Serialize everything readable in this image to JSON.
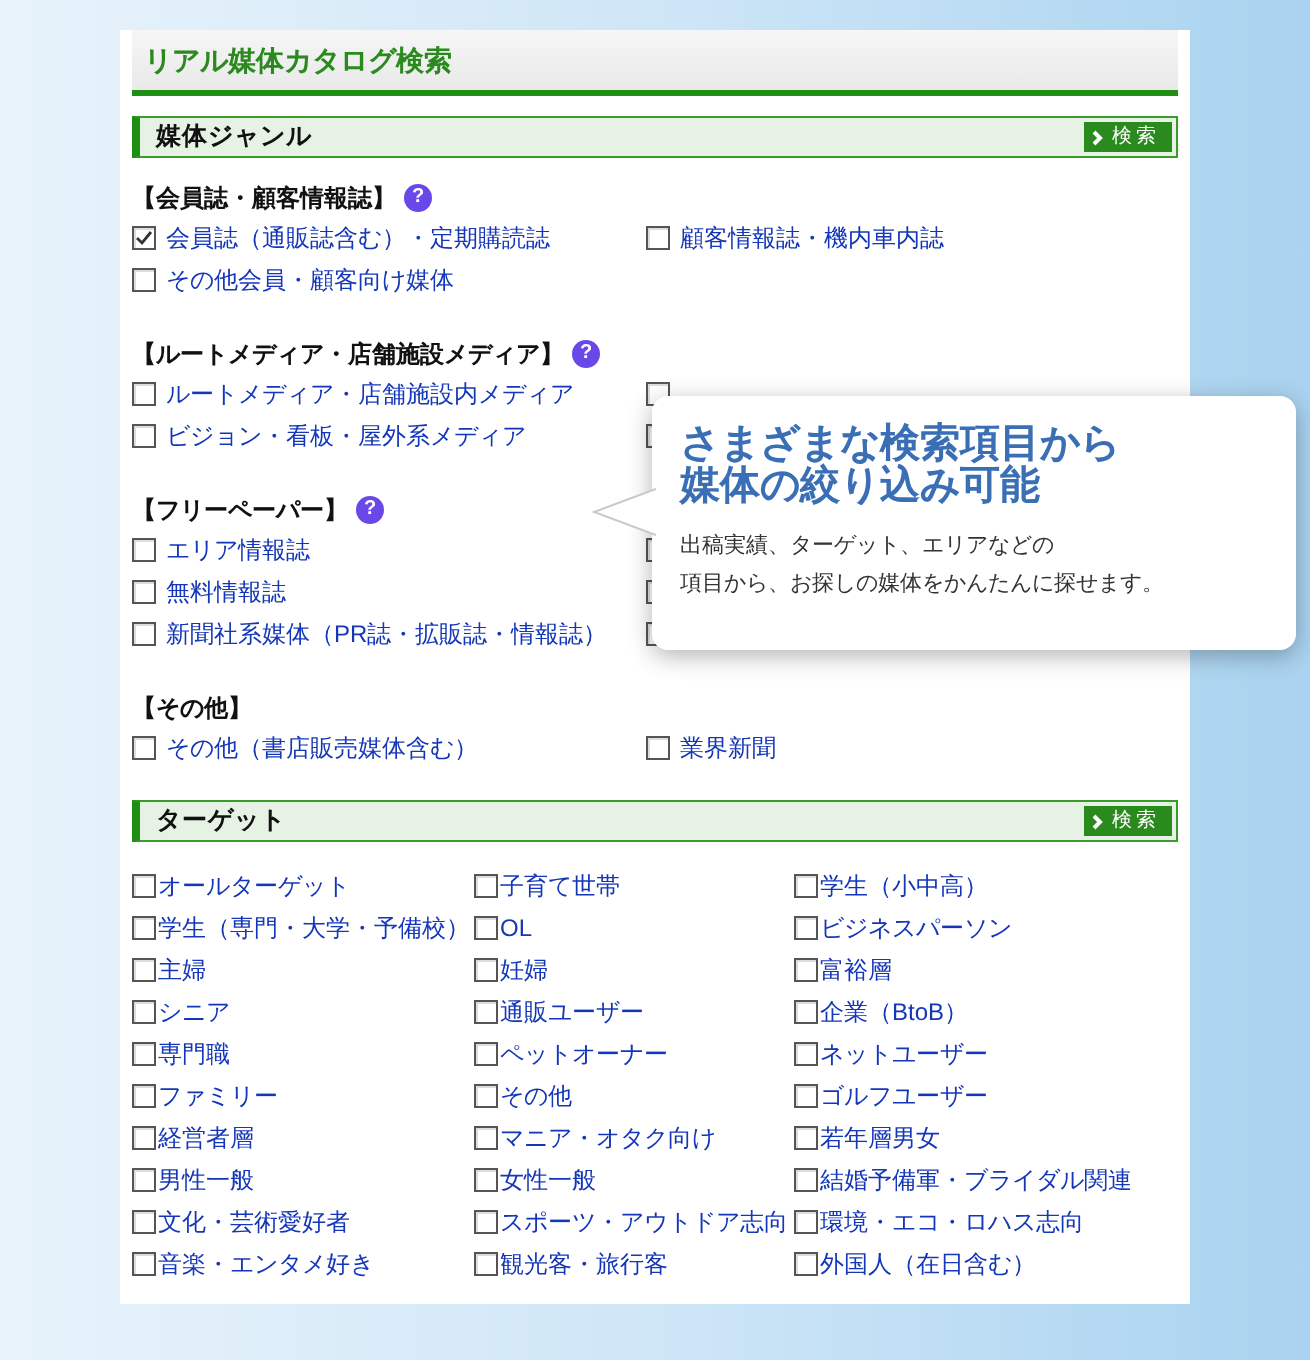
{
  "title": "リアル媒体カタログ検索",
  "genre_section": {
    "heading": "媒体ジャンル",
    "search_button": "検索",
    "groups": [
      {
        "heading": "【会員誌・顧客情報誌】",
        "help": "?",
        "items": [
          {
            "label": "会員誌（通販誌含む）・定期購読誌",
            "checked": true
          },
          {
            "label": "顧客情報誌・機内車内誌",
            "checked": false
          },
          {
            "label": "その他会員・顧客向け媒体",
            "checked": false
          }
        ]
      },
      {
        "heading": "【ルートメディア・店舗施設メディア】",
        "help": "?",
        "items": [
          {
            "label": "ルートメディア・店舗施設内メディア",
            "checked": false
          },
          {
            "checked": false
          },
          {
            "label": "ビジョン・看板・屋外系メディア",
            "checked": false
          },
          {
            "checked": false
          }
        ]
      },
      {
        "heading": "【フリーペーパー】",
        "help": "?",
        "items": [
          {
            "label": "エリア情報誌",
            "checked": false
          },
          {
            "checked": false
          },
          {
            "label": "無料情報誌",
            "checked": false
          },
          {
            "checked": false
          },
          {
            "label": "新聞社系媒体（PR誌・拡販誌・情報誌）",
            "checked": false
          },
          {
            "checked": false
          }
        ]
      },
      {
        "heading": "【その他】",
        "items": [
          {
            "label": "その他（書店販売媒体含む）",
            "checked": false
          },
          {
            "label": "業界新聞",
            "checked": false
          }
        ]
      }
    ]
  },
  "target_section": {
    "heading": "ターゲット",
    "search_button": "検索",
    "items": [
      {
        "label": "オールターゲット",
        "checked": false
      },
      {
        "label": "子育て世帯",
        "checked": false
      },
      {
        "label": "学生（小中高）",
        "checked": false
      },
      {
        "label": "学生（専門・大学・予備校）",
        "checked": false
      },
      {
        "label": "OL",
        "checked": false
      },
      {
        "label": "ビジネスパーソン",
        "checked": false
      },
      {
        "label": "主婦",
        "checked": false
      },
      {
        "label": "妊婦",
        "checked": false
      },
      {
        "label": "富裕層",
        "checked": false
      },
      {
        "label": "シニア",
        "checked": false
      },
      {
        "label": "通販ユーザー",
        "checked": false
      },
      {
        "label": "企業（BtoB）",
        "checked": false
      },
      {
        "label": "専門職",
        "checked": false
      },
      {
        "label": "ペットオーナー",
        "checked": false
      },
      {
        "label": "ネットユーザー",
        "checked": false
      },
      {
        "label": "ファミリー",
        "checked": false
      },
      {
        "label": "その他",
        "checked": false
      },
      {
        "label": "ゴルフユーザー",
        "checked": false
      },
      {
        "label": "経営者層",
        "checked": false
      },
      {
        "label": "マニア・オタク向け",
        "checked": false
      },
      {
        "label": "若年層男女",
        "checked": false
      },
      {
        "label": "男性一般",
        "checked": false
      },
      {
        "label": "女性一般",
        "checked": false
      },
      {
        "label": "結婚予備軍・ブライダル関連",
        "checked": false
      },
      {
        "label": "文化・芸術愛好者",
        "checked": false
      },
      {
        "label": "スポーツ・アウトドア志向",
        "checked": false
      },
      {
        "label": "環境・エコ・ロハス志向",
        "checked": false
      },
      {
        "label": "音楽・エンタメ好き",
        "checked": false
      },
      {
        "label": "観光客・旅行客",
        "checked": false
      },
      {
        "label": "外国人（在日含む）",
        "checked": false
      }
    ]
  },
  "callout": {
    "title_lines": [
      "さまざまな検索項目から",
      "媒体の絞り込み可能"
    ],
    "body_lines": [
      "出稿実績、ターゲット、エリアなどの",
      "項目から、お探しの媒体をかんたんに探せます。"
    ]
  }
}
